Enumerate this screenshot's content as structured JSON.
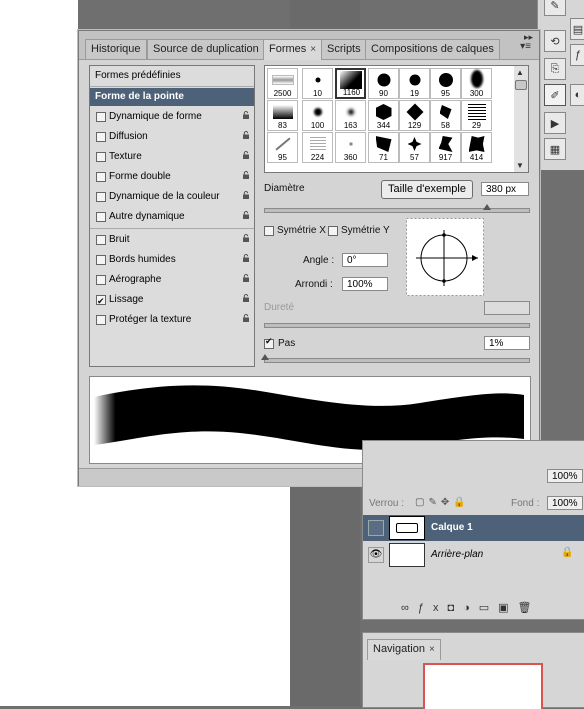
{
  "tabs": [
    "Historique",
    "Source de duplication",
    "Formes",
    "Scripts",
    "Compositions de calques"
  ],
  "active_tab_close": "×",
  "left_list": {
    "header": "Formes prédéfinies",
    "selected": "Forme de la pointe",
    "group1": [
      "Dynamique de forme",
      "Diffusion",
      "Texture",
      "Forme double",
      "Dynamique de la couleur",
      "Autre dynamique"
    ],
    "group2": [
      "Bruit",
      "Bords humides",
      "Aérographe",
      "Lissage",
      "Protéger la texture"
    ],
    "checked": [
      "Lissage"
    ]
  },
  "brushes": [
    {
      "n": "2500"
    },
    {
      "n": "10"
    },
    {
      "n": "1160"
    },
    {
      "n": "90"
    },
    {
      "n": "19"
    },
    {
      "n": "95"
    },
    {
      "n": "300"
    },
    {
      "n": "83"
    },
    {
      "n": "100"
    },
    {
      "n": "163"
    },
    {
      "n": "344"
    },
    {
      "n": "129"
    },
    {
      "n": "58"
    },
    {
      "n": "29"
    },
    {
      "n": "95"
    },
    {
      "n": "224"
    },
    {
      "n": "360"
    },
    {
      "n": "71"
    },
    {
      "n": "57"
    },
    {
      "n": "917"
    },
    {
      "n": "414"
    }
  ],
  "selected_brush": "1160",
  "diametre_label": "Diamètre",
  "taille_button": "Taille d'exemple",
  "diametre_value": "380 px",
  "sym_x": "Symétrie X",
  "sym_y": "Symétrie Y",
  "angle_label": "Angle :",
  "angle_value": "0°",
  "arrondi_label": "Arrondi :",
  "arrondi_value": "100%",
  "durete_label": "Dureté",
  "pas_label": "Pas",
  "pas_value": "1%",
  "pas_checked": true,
  "layers_panel": {
    "zoom1": "100%",
    "verrou_label": "Verrou :",
    "fond_label": "Fond :",
    "fond_value": "100%",
    "layer1": "Calque 1",
    "layer2": "Arrière-plan"
  },
  "navigation_tab": "Navigation",
  "navigation_close": "×",
  "colors": {
    "selected_row": "#4d6178",
    "panel_bg": "#d4d4d4",
    "nav_frame": "#d9534f"
  }
}
